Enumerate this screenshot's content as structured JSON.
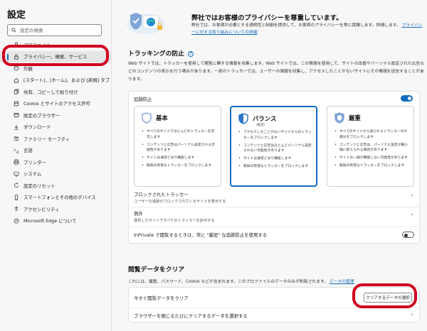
{
  "sidebar": {
    "title": "設定",
    "search_placeholder": "設定の検索",
    "items": [
      {
        "label": "プロファイル",
        "icon": "profile-icon",
        "active": false
      },
      {
        "label": "プライバシー、検索、サービス",
        "icon": "lock-icon",
        "active": true
      },
      {
        "label": "外観",
        "icon": "appearance-icon",
        "active": false
      },
      {
        "label": "[スタート]、[ホーム]、および [新規] タブ",
        "icon": "home-icon",
        "active": false
      },
      {
        "label": "共有、コピーして貼り付け",
        "icon": "share-icon",
        "active": false
      },
      {
        "label": "Cookie とサイトのアクセス許可",
        "icon": "cookie-icon",
        "active": false
      },
      {
        "label": "既定のブラウザー",
        "icon": "browser-icon",
        "active": false
      },
      {
        "label": "ダウンロード",
        "icon": "download-icon",
        "active": false
      },
      {
        "label": "ファミリー セーフティ",
        "icon": "family-icon",
        "active": false
      },
      {
        "label": "言語",
        "icon": "language-icon",
        "active": false
      },
      {
        "label": "プリンター",
        "icon": "printer-icon",
        "active": false
      },
      {
        "label": "システム",
        "icon": "system-icon",
        "active": false
      },
      {
        "label": "設定のリセット",
        "icon": "reset-icon",
        "active": false
      },
      {
        "label": "スマートフォンとその他のデバイス",
        "icon": "phone-icon",
        "active": false
      },
      {
        "label": "アクセシビリティ",
        "icon": "accessibility-icon",
        "active": false
      },
      {
        "label": "Microsoft Edge について",
        "icon": "edge-icon",
        "active": false
      }
    ]
  },
  "privacy": {
    "title": "弊社ではお客様のプライバシーを尊重しています。",
    "desc": "弊社では、お客様が必要とする透明性と制御を提供して、お客様のプライバシーを常に保護します。詳細します。",
    "link": "プライバシーに対する取り組みについての詳細"
  },
  "tracking": {
    "title": "トラッキングの防止",
    "desc": "Web サイトでは、トラッカーを使用して閲覧に関する情報を収集します。Web サイトでは、この情報を使用して、サイトの改善やパーソナル設定された広告などのコンテンツの表示を行う場合があります。一部のトラッカーでは、ユーザーの情報を収集し、アクセスしたことがないサイトにその情報を送信することがあります。",
    "toggle_label": "追跡防止",
    "levels": [
      {
        "name": "基本",
        "sub": "",
        "bullets": [
          "すべてのサイトでほとんどのトラッカーを許可します",
          "コンテンツと広告はパーソナル設定される可能性があります",
          "サイトは通常どおり機能します",
          "既知の有害なトラッカーをブロックします"
        ]
      },
      {
        "name": "バランス",
        "sub": "(推奨)",
        "bullets": [
          "アクセスしたことがないサイトからのトラッカーをブロックします",
          "コンテンツと広告はほとんどパーソナル設定されない可能性があります",
          "サイトは通常どおり機能します",
          "既知の有害なトラッカーをブロックします"
        ]
      },
      {
        "name": "厳重",
        "sub": "",
        "bullets": [
          "すべてのサイトから送られるトラッカーの大部分をブロックします",
          "コンテンツと広告は、パーソナル設定が最小限に抑えられる場合があります",
          "サイトの一部が機能しない可能性があります",
          "既知の有害なトラッカーをブロックします"
        ]
      }
    ],
    "blocked_title": "ブロックされたトラッカー",
    "blocked_sub": "ユーザーの追跡がブロックされているサイトを表示する",
    "exceptions_title": "例外",
    "exceptions_sub": "選択したサイトですべてのトラッカーを許可する",
    "inprivate_label": "InPrivate で閲覧するときは、常に \"厳密\" な追跡防止を使用する"
  },
  "clear": {
    "title": "閲覧データをクリア",
    "desc": "これには、履歴、パスワード、Cookie などが含まれます。このプロファイルのデータのみが削除されます。",
    "link": "データの管理",
    "now_label": "今すぐ閲覧データをクリア",
    "button": "クリアするデータの選択",
    "on_close_label": "ブラウザーを閉じるたびにクリアするデータを選択する"
  },
  "colors": {
    "accent": "#0f6cbd",
    "highlight": "#d1001f"
  }
}
